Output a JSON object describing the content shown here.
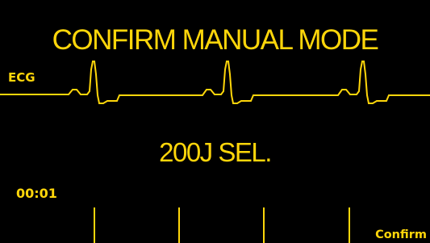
{
  "colors": {
    "background": "#000000",
    "foreground": "#ffd60a"
  },
  "display": {
    "title": "CONFIRM MANUAL MODE",
    "ecg_label": "ECG",
    "energy_selection": "200J SEL.",
    "elapsed_time": "00:01"
  },
  "softkeys": [
    {
      "label": ""
    },
    {
      "label": ""
    },
    {
      "label": ""
    },
    {
      "label": ""
    },
    {
      "label": "Confirm"
    }
  ]
}
